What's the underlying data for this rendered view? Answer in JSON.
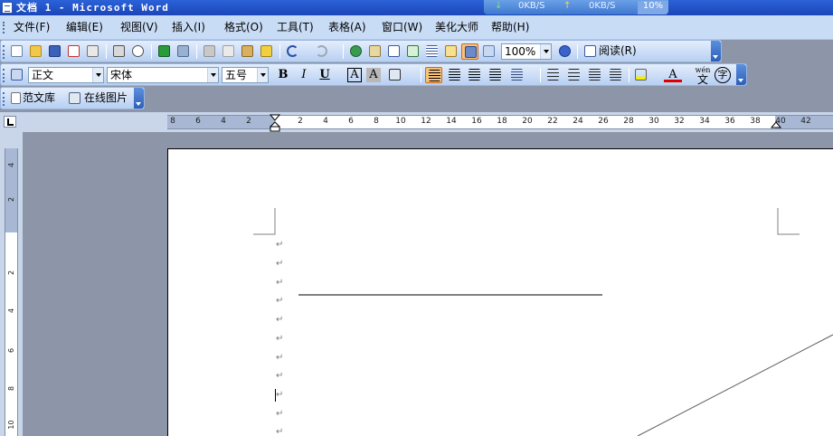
{
  "window": {
    "title": "文档 1 - Microsoft Word",
    "net_down": "0KB/S",
    "net_up": "0KB/S",
    "cpu": "10%"
  },
  "menu": [
    "文件(F)",
    "编辑(E)",
    "视图(V)",
    "插入(I)",
    "格式(O)",
    "工具(T)",
    "表格(A)",
    "窗口(W)",
    "美化大师",
    "帮助(H)"
  ],
  "standard_toolbar": {
    "zoom": "100%",
    "read_label": "阅读(R)"
  },
  "format_toolbar": {
    "style": "正文",
    "font": "宋体",
    "size": "五号",
    "bold": "B",
    "italic": "I",
    "underline": "U",
    "char_border": "A",
    "char_shading": "A",
    "font_color": "A",
    "phonetic": "wén",
    "phonetic_char": "文",
    "enclose": "字"
  },
  "extra_toolbar": {
    "library_label": "范文库",
    "online_images_label": "在线图片"
  },
  "ruler": {
    "h_ticks": [
      "8",
      "6",
      "4",
      "2",
      "2",
      "4",
      "6",
      "8",
      "10",
      "12",
      "14",
      "16",
      "18",
      "20",
      "22",
      "24",
      "26",
      "28",
      "30",
      "32",
      "34",
      "36",
      "38",
      "40",
      "42"
    ],
    "v_ticks": [
      "4",
      "2",
      "2",
      "4",
      "6",
      "8",
      "10"
    ]
  },
  "colors": {
    "title_bg": "#1a46b8",
    "menu_bg": "#c9dcf5",
    "active_button": "#f8c27a",
    "workspace": "#8c96a8"
  }
}
